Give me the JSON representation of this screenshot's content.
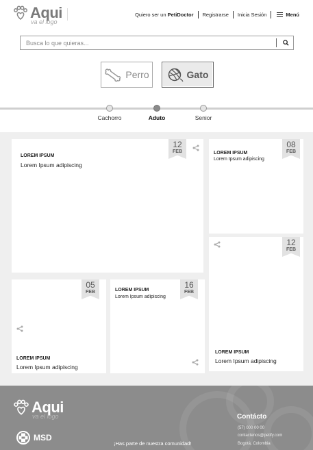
{
  "header": {
    "logo_text": "Aqui",
    "logo_tagline": "va el logo",
    "nav": {
      "doctor_prefix": "Quiero ser un ",
      "doctor_brand": "PetiDoctor",
      "register": "Registrarse",
      "login": "Inicia Sesión",
      "menu": "Menú"
    }
  },
  "search": {
    "placeholder": "Busca lo que quieras..."
  },
  "pets": {
    "dog": "Perro",
    "cat": "Gato",
    "selected": "Gato"
  },
  "stages": {
    "items": [
      "Cachorro",
      "Aduto",
      "Senior"
    ],
    "active": "Aduto"
  },
  "cards": [
    {
      "day": "12",
      "month": "FEB",
      "title": "LOREM IPSUM",
      "subtitle": "Lorem Ipsum  adipiscing"
    },
    {
      "day": "08",
      "month": "FEB",
      "title": "LOREM IPSUM",
      "subtitle": "Lorem Ipsum  adipiscing"
    },
    {
      "day": "12",
      "month": "FEB",
      "title": "LOREM IPSUM",
      "subtitle": "Lorem Ipsum  adipiscing"
    },
    {
      "day": "05",
      "month": "FEB",
      "title": "LOREM IPSUM",
      "subtitle": "Lorem Ipsum  adipiscing"
    },
    {
      "day": "16",
      "month": "FEB",
      "title": "LOREM IPSUM",
      "subtitle": "Lorem Ipsum  adipiscing"
    }
  ],
  "footer": {
    "logo_text": "Aqui",
    "logo_tagline": "va el logo",
    "sponsor": "MSD",
    "community": "¡Has parte de nuestra comunidad!",
    "contact_title": "Contácto",
    "phone": "(57) 000 00 00",
    "email": "contactenos@petify.com",
    "city": "Bogotá, Colombia"
  },
  "colors": {
    "footer_bg": "#8c8c8c",
    "content_bg": "#efefef",
    "date_badge": "#e2e2e2"
  }
}
